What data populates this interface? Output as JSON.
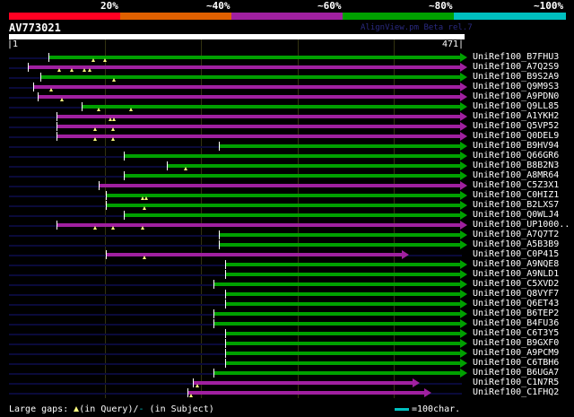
{
  "header": {
    "pct_labels": [
      "20%",
      "~40%",
      "~60%",
      "~80%",
      "~100%"
    ],
    "pct_colors": [
      "#ff0022",
      "#e06000",
      "#a020a0",
      "#00a000",
      "#00c0c0"
    ],
    "query_name": "AV773021",
    "version": "AlignView.pm Beta rel.7",
    "start_tick": "|1",
    "end_tick": "471|",
    "query_length": 471
  },
  "colors": {
    "green": "#00a000",
    "purple": "#a020a0"
  },
  "hits": [
    {
      "name": "UniRef100_B7FHU3",
      "start": 41,
      "end": 471,
      "color": "green",
      "gaps": [
        88,
        100
      ]
    },
    {
      "name": "UniRef100_A7Q2S9",
      "start": 20,
      "end": 471,
      "color": "purple",
      "gaps": [
        52,
        65,
        78,
        84
      ]
    },
    {
      "name": "UniRef100_B9S2A9",
      "start": 33,
      "end": 471,
      "color": "green",
      "gaps": [
        109
      ]
    },
    {
      "name": "UniRef100_Q9M9S3",
      "start": 25,
      "end": 471,
      "color": "purple",
      "gaps": [
        44
      ]
    },
    {
      "name": "UniRef100_A9PDN0",
      "start": 30,
      "end": 471,
      "color": "purple",
      "gaps": [
        55
      ]
    },
    {
      "name": "UniRef100_Q9LL85",
      "start": 76,
      "end": 471,
      "color": "green",
      "gaps": [
        93,
        127
      ]
    },
    {
      "name": "UniRef100_A1YKH2",
      "start": 49,
      "end": 471,
      "color": "purple",
      "gaps": [
        105,
        109
      ]
    },
    {
      "name": "UniRef100_Q5VP52",
      "start": 49,
      "end": 471,
      "color": "purple",
      "gaps": [
        90,
        108
      ]
    },
    {
      "name": "UniRef100_Q0DEL9",
      "start": 49,
      "end": 471,
      "color": "purple",
      "gaps": [
        90,
        108
      ]
    },
    {
      "name": "UniRef100_B9HV94",
      "start": 218,
      "end": 471,
      "color": "green",
      "gaps": []
    },
    {
      "name": "UniRef100_Q66GR6",
      "start": 119,
      "end": 471,
      "color": "green",
      "gaps": []
    },
    {
      "name": "UniRef100_B8B2N3",
      "start": 164,
      "end": 471,
      "color": "green",
      "gaps": [
        184
      ]
    },
    {
      "name": "UniRef100_A8MR64",
      "start": 119,
      "end": 471,
      "color": "green",
      "gaps": []
    },
    {
      "name": "UniRef100_C5Z3X1",
      "start": 93,
      "end": 471,
      "color": "purple",
      "gaps": []
    },
    {
      "name": "UniRef100_C0HIZ1",
      "start": 101,
      "end": 471,
      "color": "green",
      "gaps": [
        139,
        143
      ]
    },
    {
      "name": "UniRef100_B2LXS7",
      "start": 101,
      "end": 471,
      "color": "green",
      "gaps": [
        141
      ]
    },
    {
      "name": "UniRef100_Q0WLJ4",
      "start": 119,
      "end": 471,
      "color": "green",
      "gaps": []
    },
    {
      "name": "UniRef100_UP1000..",
      "start": 49,
      "end": 471,
      "color": "purple",
      "gaps": [
        90,
        108,
        139
      ]
    },
    {
      "name": "UniRef100_A7Q7T2",
      "start": 218,
      "end": 471,
      "color": "green",
      "gaps": []
    },
    {
      "name": "UniRef100_A5B3B9",
      "start": 218,
      "end": 471,
      "color": "green",
      "gaps": []
    },
    {
      "name": "UniRef100_C0P415",
      "start": 101,
      "end": 410,
      "color": "purple",
      "gaps": [
        141
      ]
    },
    {
      "name": "UniRef100_A9NQE8",
      "start": 225,
      "end": 471,
      "color": "green",
      "gaps": []
    },
    {
      "name": "UniRef100_A9NLD1",
      "start": 225,
      "end": 471,
      "color": "green",
      "gaps": []
    },
    {
      "name": "UniRef100_C5XVD2",
      "start": 213,
      "end": 471,
      "color": "green",
      "gaps": []
    },
    {
      "name": "UniRef100_Q8VYF7",
      "start": 225,
      "end": 471,
      "color": "green",
      "gaps": []
    },
    {
      "name": "UniRef100_Q6ET43",
      "start": 225,
      "end": 471,
      "color": "green",
      "gaps": []
    },
    {
      "name": "UniRef100_B6TEP2",
      "start": 213,
      "end": 471,
      "color": "green",
      "gaps": []
    },
    {
      "name": "UniRef100_B4FU36",
      "start": 213,
      "end": 471,
      "color": "green",
      "gaps": []
    },
    {
      "name": "UniRef100_C6T3Y5",
      "start": 225,
      "end": 471,
      "color": "green",
      "gaps": []
    },
    {
      "name": "UniRef100_B9GXF0",
      "start": 225,
      "end": 471,
      "color": "green",
      "gaps": []
    },
    {
      "name": "UniRef100_A9PCM9",
      "start": 225,
      "end": 471,
      "color": "green",
      "gaps": []
    },
    {
      "name": "UniRef100_C6TBH6",
      "start": 225,
      "end": 471,
      "color": "green",
      "gaps": []
    },
    {
      "name": "UniRef100_B6UGA7",
      "start": 213,
      "end": 471,
      "color": "green",
      "gaps": []
    },
    {
      "name": "UniRef100_C1N7R5",
      "start": 191,
      "end": 422,
      "color": "purple",
      "gaps": [
        196
      ]
    },
    {
      "name": "UniRef100_C1FHQ2",
      "start": 186,
      "end": 434,
      "color": "purple",
      "gaps": [
        189
      ]
    }
  ],
  "legend": {
    "prefix": "Large gaps:",
    "query": "(in Query)/",
    "dash": "-",
    "subject": " (in Subject)",
    "scale": "=100char."
  }
}
